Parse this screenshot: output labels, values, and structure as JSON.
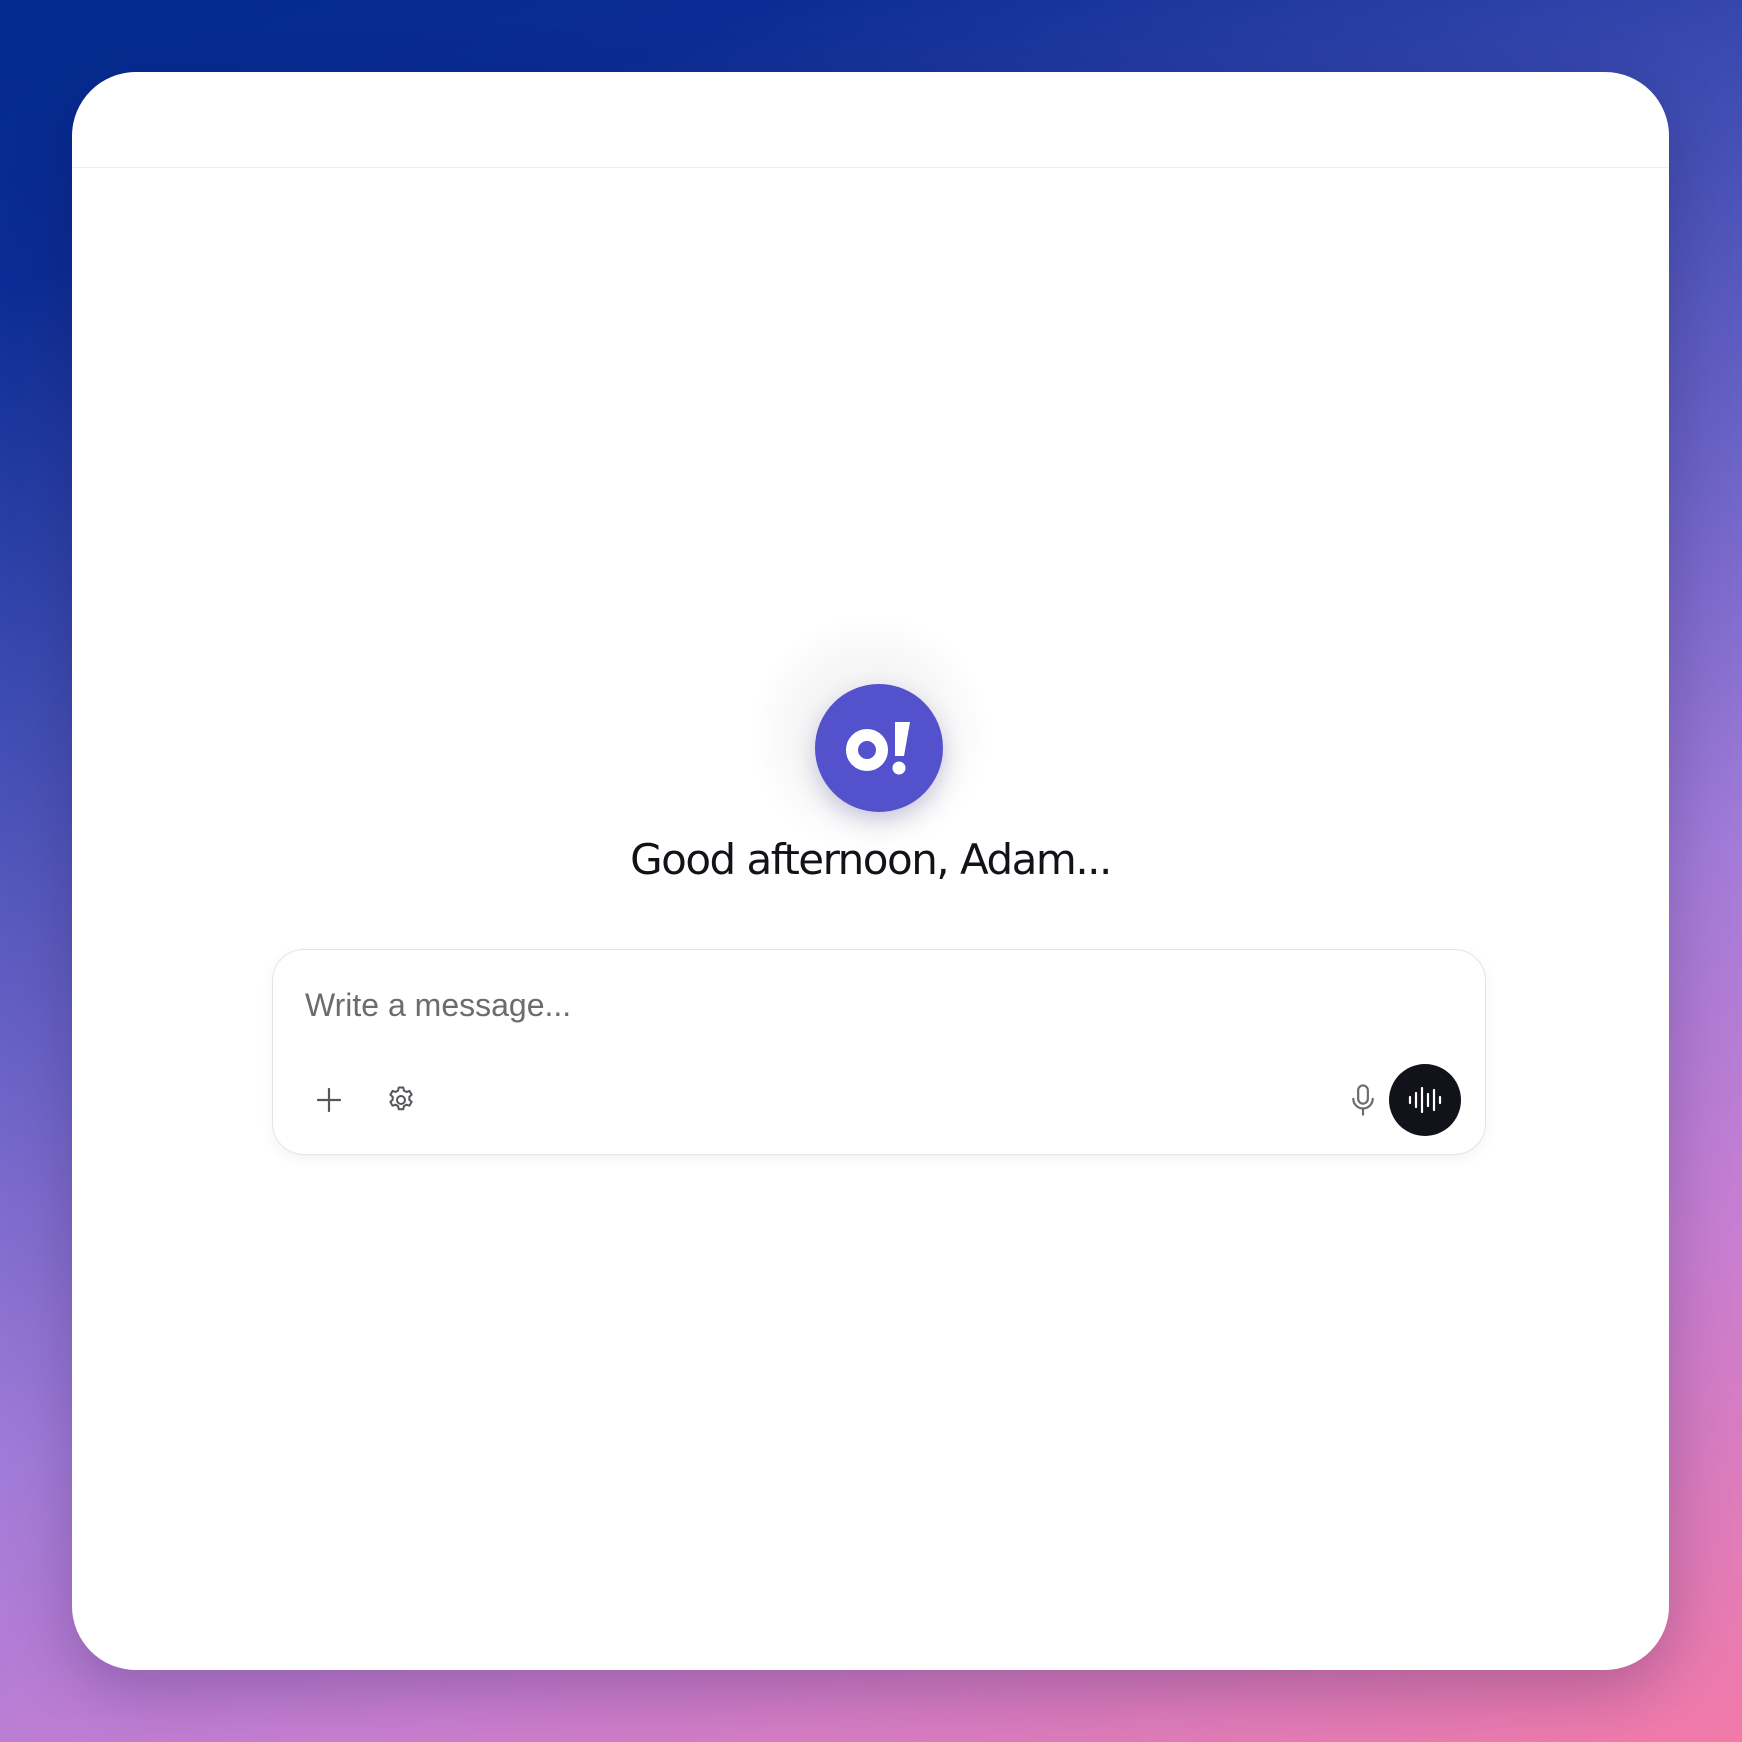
{
  "app": {
    "logo_text": "o!",
    "greeting": "Good afternoon, Adam..."
  },
  "composer": {
    "placeholder": "Write a message...",
    "value": "",
    "add_icon": "plus-icon",
    "settings_icon": "gear-icon",
    "mic_icon": "microphone-icon",
    "voice_icon": "audio-waveform-icon"
  },
  "colors": {
    "brand": "#5451cc",
    "voice_button": "#12131a",
    "text": "#111318",
    "placeholder": "#6b6b70"
  }
}
